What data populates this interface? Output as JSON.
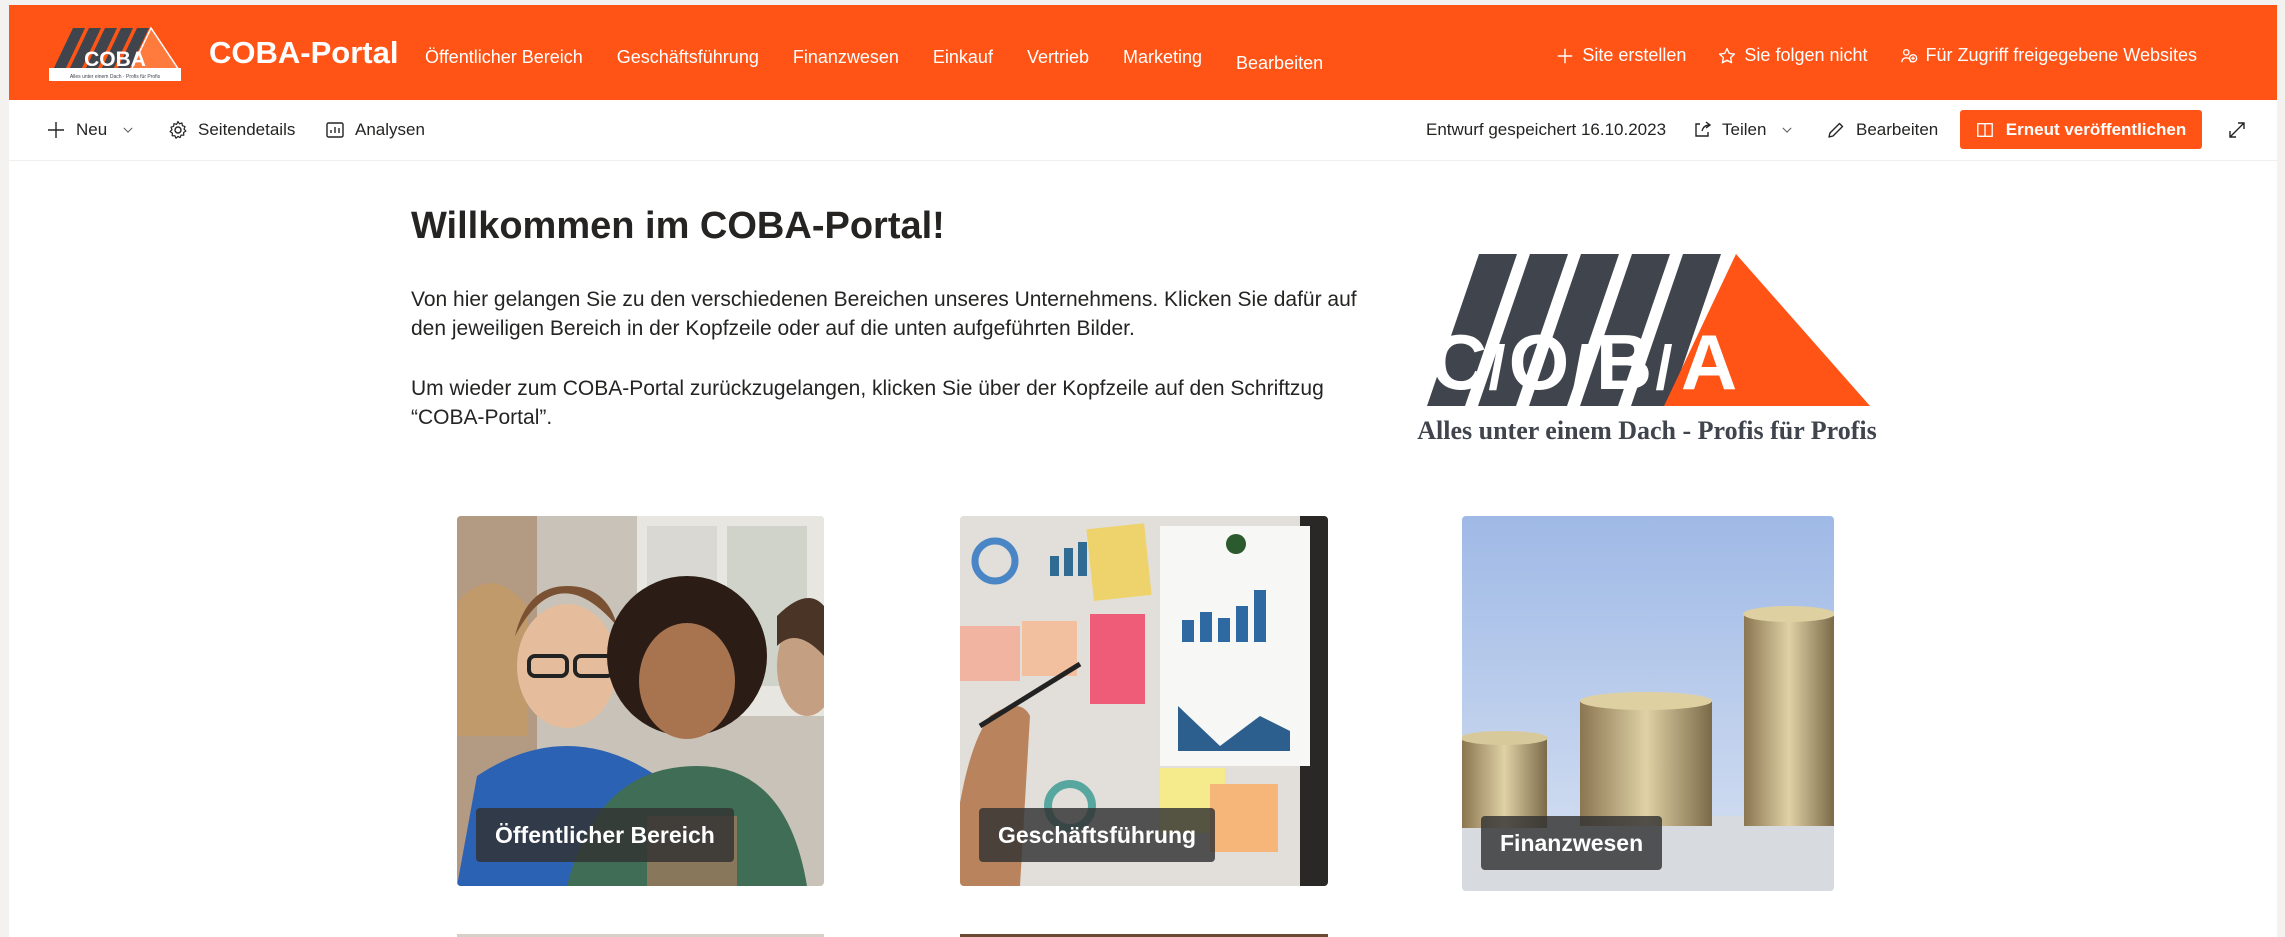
{
  "suite_header": {
    "site_title": "COBA-Portal",
    "nav": [
      {
        "label": "Öffentlicher Bereich"
      },
      {
        "label": "Geschäftsführung"
      },
      {
        "label": "Finanzwesen"
      },
      {
        "label": "Einkauf"
      },
      {
        "label": "Vertrieb"
      },
      {
        "label": "Marketing"
      },
      {
        "label": "Bearbeiten"
      }
    ],
    "actions": {
      "create_site": "Site erstellen",
      "not_following": "Sie folgen nicht",
      "shared_sites": "Für Zugriff freigegebene Websites"
    },
    "logo_text": "COBA",
    "logo_tagline_small": "Alles unter einem Dach · Profis für Profis"
  },
  "command_bar": {
    "new": "Neu",
    "page_details": "Seitendetails",
    "analytics": "Analysen",
    "draft_status": "Entwurf gespeichert 16.10.2023",
    "share": "Teilen",
    "edit": "Bearbeiten",
    "republish": "Erneut veröffentlichen"
  },
  "content": {
    "title": "Willkommen im COBA-Portal!",
    "paragraph_1": "Von hier gelangen Sie zu den verschiedenen Bereichen unseres Unternehmens. Klicken Sie dafür auf den jeweiligen Bereich in der Kopfzeile oder auf die unten aufgeführten Bilder.",
    "paragraph_2": "Um wieder zum COBA-Portal zurückzugelangen, klicken Sie über der Kopfzeile auf den Schriftzug “COBA-Portal”.",
    "logo_tagline": "Alles unter einem Dach - Profis für Profis"
  },
  "tiles": [
    {
      "label": "Öffentlicher Bereich"
    },
    {
      "label": "Geschäftsführung"
    },
    {
      "label": "Finanzwesen"
    }
  ],
  "colors": {
    "brand_orange": "#ff5416",
    "logo_gray": "#3f444d"
  },
  "icons": [
    "plus-icon",
    "chevron-down-icon",
    "gear-icon",
    "analytics-icon",
    "share-icon",
    "pencil-icon",
    "book-icon",
    "expand-icon",
    "star-icon",
    "people-icon"
  ]
}
